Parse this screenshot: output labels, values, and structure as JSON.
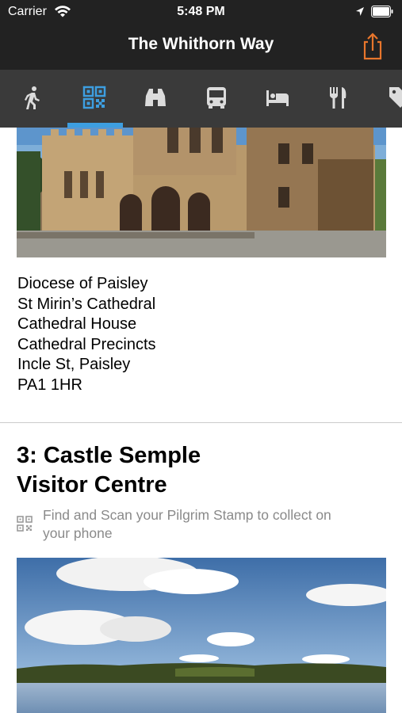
{
  "status_bar": {
    "carrier": "Carrier",
    "time": "5:48 PM",
    "icons": [
      "wifi-icon",
      "location-arrow-icon",
      "battery-icon"
    ]
  },
  "nav": {
    "title": "The Whithorn Way",
    "share_icon": "share-icon",
    "accent_color": "#e8762c"
  },
  "tabs": [
    {
      "icon": "walking-icon",
      "selected": false
    },
    {
      "icon": "qr-code-icon",
      "selected": true
    },
    {
      "icon": "binoculars-icon",
      "selected": false
    },
    {
      "icon": "bus-icon",
      "selected": false
    },
    {
      "icon": "bed-icon",
      "selected": false
    },
    {
      "icon": "fork-knife-icon",
      "selected": false
    },
    {
      "icon": "tag-icon",
      "selected": false
    }
  ],
  "tab_colors": {
    "selected": "#3d9ee0",
    "unselected": "#dcdcdc",
    "indicator": "#3d9ee0"
  },
  "stop2": {
    "image": "cathedral-photo",
    "address_lines": [
      "Diocese of Paisley",
      "St Mirin’s Cathedral",
      "Cathedral House",
      "Cathedral Precincts",
      "Incle St, Paisley",
      "PA1 1HR"
    ]
  },
  "stop3": {
    "title_line1": "3: Castle Semple",
    "title_line2": "Visitor Centre",
    "stamp_line1": "Find and Scan your Pilgrim Stamp to collect on",
    "stamp_line2": "your phone",
    "image": "loch-photo"
  }
}
